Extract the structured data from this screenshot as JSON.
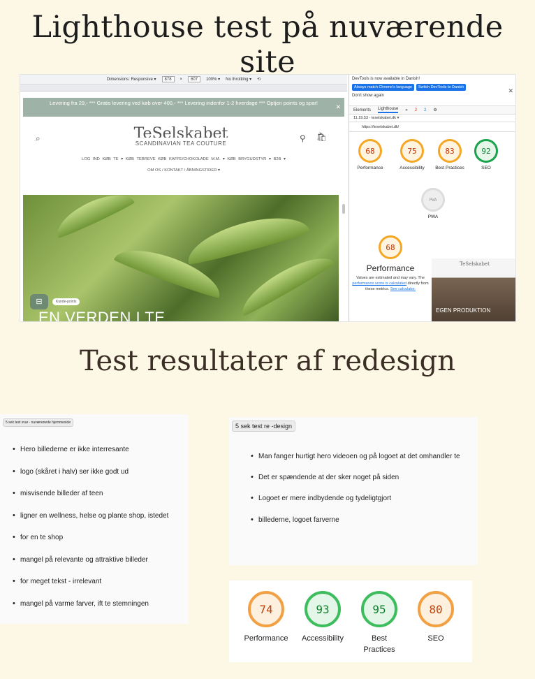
{
  "title_top": "Lighthouse test på nuværende site",
  "title_mid": "Test resultater af redesign",
  "devtools_bar": {
    "dimensions_label": "Dimensions: Responsive ▾",
    "width": "878",
    "x": "×",
    "height": "607",
    "zoom": "100% ▾",
    "throttling": "No throttling ▾"
  },
  "site": {
    "banner": "Levering fra 29,- *** Gratis levering ved køb over 400,- *** Levering indenfor 1-2 hverdage *** Optjen points og spar!",
    "logo": "TeSelskabet",
    "logo_sub": "SCANDINAVIAN TEA COUTURE",
    "nav1": "LOG IND   KØB TE ▾   KØB TEBREVE   KØB KAFFE/CHOKOLADE M.M. ▾   KØB BRYGUDSTYR ▾   B2B ▾",
    "nav2": "OM OS / KONTAKT / ÅBNINGSTIDER ▾",
    "hero_pill": "Kunde-points",
    "hero_text": "EN VERDEN I TE"
  },
  "devtools": {
    "notice": "DevTools is now available in Danish!",
    "btn_match": "Always match Chrome's language",
    "btn_switch": "Switch DevTools to Danish",
    "dont_show": "Don't show again",
    "tab_elements": "Elements",
    "tab_lighthouse": "Lighthouse",
    "tab_more": "»",
    "errors": "2",
    "warnings": "2",
    "session": "11.19.53 - teselskabet.dk ▾",
    "url": "https://teselskabet.dk/",
    "gauges": [
      {
        "value": "68",
        "label": "Performance",
        "kind": "o"
      },
      {
        "value": "75",
        "label": "Accessibility",
        "kind": "o"
      },
      {
        "value": "83",
        "label": "Best Practices",
        "kind": "o"
      },
      {
        "value": "92",
        "label": "SEO",
        "kind": "g"
      }
    ],
    "pwa_label": "PWA",
    "pwa_inner": "PWA",
    "perf_value": "68",
    "perf_title": "Performance",
    "perf_note_1": "Values are estimated and may vary. The",
    "perf_note_link": "performance score is calculated",
    "perf_note_2": "directly from these metrics.",
    "perf_note_link2": "See calculator.",
    "thumb_logo": "TeSelskabet",
    "thumb_text": "EGEN PRODUKTION"
  },
  "card_left": {
    "tag": "5 sek test svar - nuværenede hjemmeside",
    "items": [
      "Hero billederne er ikke interresante",
      "logo (skåret i halv) ser ikke godt ud",
      "misvisende billeder af teen",
      "ligner en wellness, helse og plante shop, istedet",
      "for en te shop",
      "mangel på relevante og attraktive billeder",
      "for meget tekst - irrelevant",
      "mangel på varme farver, ift te stemningen"
    ]
  },
  "card_right": {
    "tag": "5 sek test re -design",
    "items": [
      "Man fanger hurtigt hero videoen og på logoet at det omhandler te",
      "Det er spændende at der sker noget på siden",
      "Logoet er mere indbydende og tydeligtgjort",
      "billederne, logoet farverne"
    ]
  },
  "scores": [
    {
      "value": "74",
      "label": "Performance",
      "kind": "o"
    },
    {
      "value": "93",
      "label": "Accessibility",
      "kind": "g"
    },
    {
      "value": "95",
      "label": "Best Practices",
      "kind": "g"
    },
    {
      "value": "80",
      "label": "SEO",
      "kind": "o"
    }
  ],
  "colors": {
    "background": "#fdf7e6",
    "orange": "#f2a044",
    "green": "#3ebd5e",
    "banner": "#9fb2a7"
  }
}
